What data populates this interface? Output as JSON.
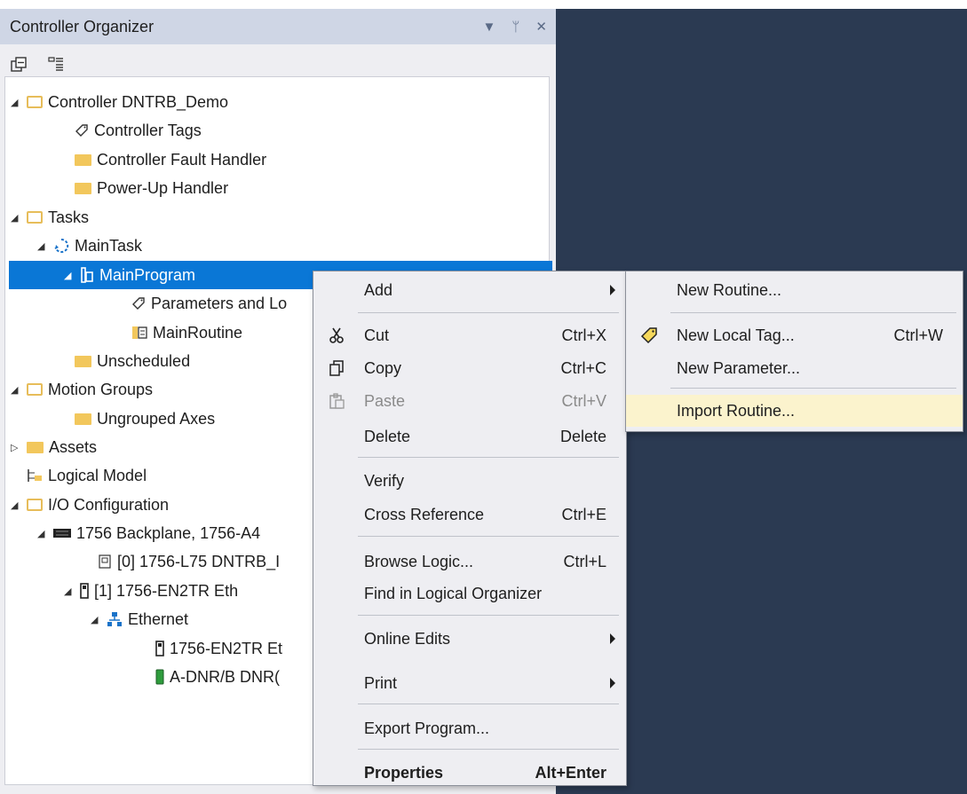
{
  "panel": {
    "title": "Controller Organizer",
    "header_buttons": [
      "▼",
      "ᛘ",
      "✕"
    ]
  },
  "tree": [
    {
      "label": "Controller DNTRB_Demo",
      "icon": "folder-open-icon",
      "expander": "◢"
    },
    {
      "label": "Controller Tags",
      "icon": "tag-icon",
      "expander": ""
    },
    {
      "label": "Controller Fault Handler",
      "icon": "folder-icon",
      "expander": ""
    },
    {
      "label": "Power-Up Handler",
      "icon": "folder-icon",
      "expander": ""
    },
    {
      "label": "Tasks",
      "icon": "folder-open-icon",
      "expander": "◢"
    },
    {
      "label": "MainTask",
      "icon": "task-icon",
      "expander": "◢"
    },
    {
      "label": "MainProgram",
      "icon": "program-icon",
      "expander": "◢"
    },
    {
      "label": "Parameters and Lo",
      "icon": "tag-icon",
      "expander": ""
    },
    {
      "label": "MainRoutine",
      "icon": "routine-icon",
      "expander": ""
    },
    {
      "label": "Unscheduled",
      "icon": "folder-icon",
      "expander": ""
    },
    {
      "label": "Motion Groups",
      "icon": "folder-open-icon",
      "expander": "◢"
    },
    {
      "label": "Ungrouped Axes",
      "icon": "folder-icon",
      "expander": ""
    },
    {
      "label": "Assets",
      "icon": "folder-icon",
      "expander": "▷"
    },
    {
      "label": "Logical Model",
      "icon": "logical-model-icon",
      "expander": ""
    },
    {
      "label": "I/O Configuration",
      "icon": "folder-open-icon",
      "expander": "◢"
    },
    {
      "label": "1756 Backplane, 1756-A4",
      "icon": "backplane-icon",
      "expander": "◢"
    },
    {
      "label": "[0] 1756-L75 DNTRB_I",
      "icon": "controller-module-icon",
      "expander": ""
    },
    {
      "label": "[1] 1756-EN2TR Eth",
      "icon": "module-icon",
      "expander": "◢"
    },
    {
      "label": "Ethernet",
      "icon": "network-icon",
      "expander": "◢"
    },
    {
      "label": "1756-EN2TR Et",
      "icon": "module-icon",
      "expander": ""
    },
    {
      "label": "A-DNR/B DNR(",
      "icon": "device-icon",
      "expander": ""
    }
  ],
  "context_menu": {
    "items": [
      {
        "label": "Add",
        "shortcut": "",
        "submenu": true
      },
      {
        "label": "Cut",
        "shortcut": "Ctrl+X",
        "icon": "scissors-icon"
      },
      {
        "label": "Copy",
        "shortcut": "Ctrl+C",
        "icon": "copy-icon"
      },
      {
        "label": "Paste",
        "shortcut": "Ctrl+V",
        "icon": "paste-icon",
        "disabled": true
      },
      {
        "label": "Delete",
        "shortcut": "Delete"
      },
      {
        "label": "Verify",
        "shortcut": ""
      },
      {
        "label": "Cross Reference",
        "shortcut": "Ctrl+E"
      },
      {
        "label": "Browse Logic...",
        "shortcut": "Ctrl+L"
      },
      {
        "label": "Find in Logical Organizer",
        "shortcut": ""
      },
      {
        "label": "Online Edits",
        "shortcut": "",
        "submenu": true
      },
      {
        "label": "Print",
        "shortcut": "",
        "submenu": true
      },
      {
        "label": "Export Program...",
        "shortcut": ""
      },
      {
        "label": "Properties",
        "shortcut": "Alt+Enter",
        "bold": true
      }
    ]
  },
  "submenu": {
    "items": [
      {
        "label": "New Routine...",
        "shortcut": ""
      },
      {
        "label": "New Local Tag...",
        "shortcut": "Ctrl+W",
        "icon": "tag-icon"
      },
      {
        "label": "New Parameter...",
        "shortcut": ""
      },
      {
        "label": "Import Routine...",
        "shortcut": "",
        "highlighted": true
      }
    ]
  },
  "colors": {
    "selection": "#0a77d6",
    "highlight": "#fbf3cd",
    "background_dark": "#2b3a52",
    "folder": "#f2c75c"
  }
}
